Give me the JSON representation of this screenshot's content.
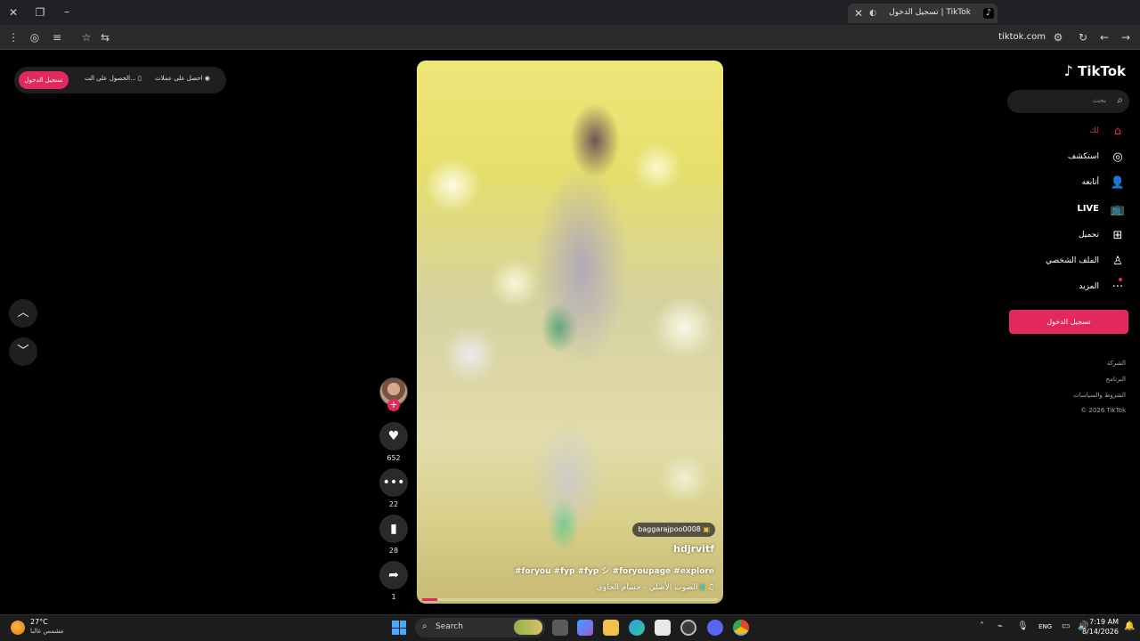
{
  "browser": {
    "tab_title": "تسجيل الدخول | TikTok",
    "url": "tiktok.com"
  },
  "topbar": {
    "get_coins": "احصل على عملات",
    "get_app": "الحصول على الت...",
    "login": "تسجيل الدخول"
  },
  "sidebar": {
    "logo": "TikTok",
    "search_placeholder": "بحث",
    "items": [
      {
        "label": "لك",
        "icon": "home-icon"
      },
      {
        "label": "استكشف",
        "icon": "compass-icon"
      },
      {
        "label": "أتابعه",
        "icon": "following-icon"
      },
      {
        "label": "LIVE",
        "icon": "live-tv-icon"
      },
      {
        "label": "تحميل",
        "icon": "upload-icon"
      },
      {
        "label": "الملف الشخصي",
        "icon": "profile-icon"
      },
      {
        "label": "المزيد",
        "icon": "more-icon"
      }
    ],
    "login_button": "تسجيل الدخول",
    "footer": [
      "الشركة",
      "البرنامج",
      "الشروط والسياسات",
      "© 2026 TikTok"
    ]
  },
  "video": {
    "badge": "baggarajpoo0008",
    "author": "hdjrvitf",
    "caption": "#foryou #fyp #fyp シ #foryoupage #explore",
    "music": "الصوت الأصلي - حسام الحاوي",
    "progress": 0.05
  },
  "actions": {
    "likes": "652",
    "comments": "22",
    "saves": "28",
    "shares": "1"
  },
  "taskbar": {
    "temperature": "27°C",
    "weather": "مشمس غالبا",
    "search": "Search",
    "language": "ENG",
    "time": "7:19 AM",
    "date": "8/14/2026"
  },
  "colors": {
    "accent": "#e1295e",
    "background": "#000000"
  }
}
